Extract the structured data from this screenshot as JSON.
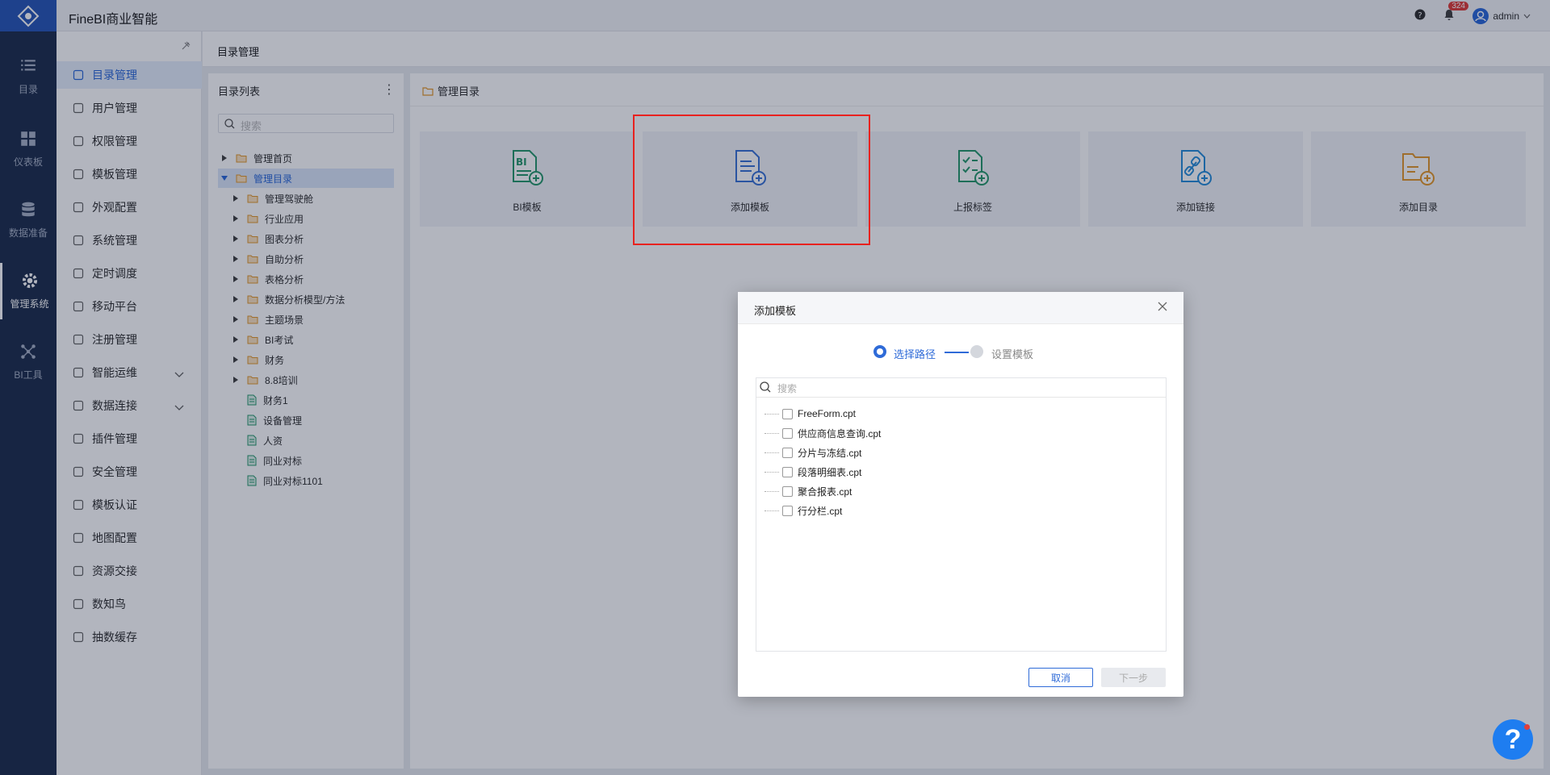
{
  "app": {
    "brand": "FineBI商业智能"
  },
  "topbar": {
    "notification_count": "324",
    "user": "admin"
  },
  "rail": {
    "items": [
      {
        "label": "目录",
        "icon": "list-icon"
      },
      {
        "label": "仪表板",
        "icon": "dashboard-icon"
      },
      {
        "label": "数据准备",
        "icon": "database-icon"
      },
      {
        "label": "管理系统",
        "icon": "gear-icon",
        "active": true
      },
      {
        "label": "BI工具",
        "icon": "network-icon"
      }
    ]
  },
  "nav": {
    "items": [
      {
        "label": "目录管理",
        "icon": "catalog-icon",
        "active": true
      },
      {
        "label": "用户管理",
        "icon": "user-icon"
      },
      {
        "label": "权限管理",
        "icon": "lock-icon"
      },
      {
        "label": "模板管理",
        "icon": "template-icon"
      },
      {
        "label": "外观配置",
        "icon": "brush-icon"
      },
      {
        "label": "系统管理",
        "icon": "settings-icon"
      },
      {
        "label": "定时调度",
        "icon": "timer-icon"
      },
      {
        "label": "移动平台",
        "icon": "mobile-icon"
      },
      {
        "label": "注册管理",
        "icon": "register-icon"
      },
      {
        "label": "智能运维",
        "icon": "ops-icon",
        "expandable": true
      },
      {
        "label": "数据连接",
        "icon": "link-icon",
        "expandable": true
      },
      {
        "label": "插件管理",
        "icon": "plugin-icon"
      },
      {
        "label": "安全管理",
        "icon": "shield-icon"
      },
      {
        "label": "模板认证",
        "icon": "cert-icon"
      },
      {
        "label": "地图配置",
        "icon": "map-icon"
      },
      {
        "label": "资源交接",
        "icon": "transfer-icon"
      },
      {
        "label": "数知鸟",
        "icon": "bird-icon"
      },
      {
        "label": "抽数缓存",
        "icon": "cache-icon"
      }
    ]
  },
  "page": {
    "title": "目录管理"
  },
  "tree": {
    "title": "目录列表",
    "search_placeholder": "搜索",
    "nodes": [
      {
        "label": "管理首页",
        "type": "folder",
        "level": 0,
        "expanded": false
      },
      {
        "label": "管理目录",
        "type": "folder",
        "level": 0,
        "expanded": true,
        "selected": true
      },
      {
        "label": "管理驾驶舱",
        "type": "folder",
        "level": 1
      },
      {
        "label": "行业应用",
        "type": "folder",
        "level": 1
      },
      {
        "label": "图表分析",
        "type": "folder",
        "level": 1
      },
      {
        "label": "自助分析",
        "type": "folder",
        "level": 1
      },
      {
        "label": "表格分析",
        "type": "folder",
        "level": 1
      },
      {
        "label": "数据分析模型/方法",
        "type": "folder",
        "level": 1
      },
      {
        "label": "主题场景",
        "type": "folder",
        "level": 1
      },
      {
        "label": "BI考试",
        "type": "folder",
        "level": 1
      },
      {
        "label": "财务",
        "type": "folder",
        "level": 1
      },
      {
        "label": "8.8培训",
        "type": "folder",
        "level": 1
      },
      {
        "label": "财务1",
        "type": "file",
        "level": 1
      },
      {
        "label": "设备管理",
        "type": "file",
        "level": 1
      },
      {
        "label": "人资",
        "type": "file",
        "level": 1
      },
      {
        "label": "同业对标",
        "type": "file",
        "level": 1
      },
      {
        "label": "同业对标1101",
        "type": "file",
        "level": 1
      }
    ]
  },
  "main": {
    "crumb": "管理目录",
    "cards": [
      {
        "label": "BI模板",
        "icon": "bi-template-icon",
        "color": "#2a9a6e"
      },
      {
        "label": "添加模板",
        "icon": "add-template-icon",
        "color": "#3d74d6"
      },
      {
        "label": "上报标签",
        "icon": "report-tag-icon",
        "color": "#2a9a6e"
      },
      {
        "label": "添加链接",
        "icon": "add-link-icon",
        "color": "#2a8fd8"
      },
      {
        "label": "添加目录",
        "icon": "add-folder-icon",
        "color": "#e49a2e"
      }
    ]
  },
  "dialog": {
    "title": "添加模板",
    "steps": [
      {
        "label": "选择路径",
        "active": true
      },
      {
        "label": "设置模板",
        "active": false
      }
    ],
    "search_placeholder": "搜索",
    "files": [
      "FreeForm.cpt",
      "供应商信息查询.cpt",
      "分片与冻结.cpt",
      "段落明细表.cpt",
      "聚合报表.cpt",
      "行分栏.cpt"
    ],
    "cancel_label": "取消",
    "next_label": "下一步"
  },
  "colors": {
    "accent": "#2f6bd8",
    "rail_bg": "#22324f",
    "highlight": "#e8221f"
  }
}
